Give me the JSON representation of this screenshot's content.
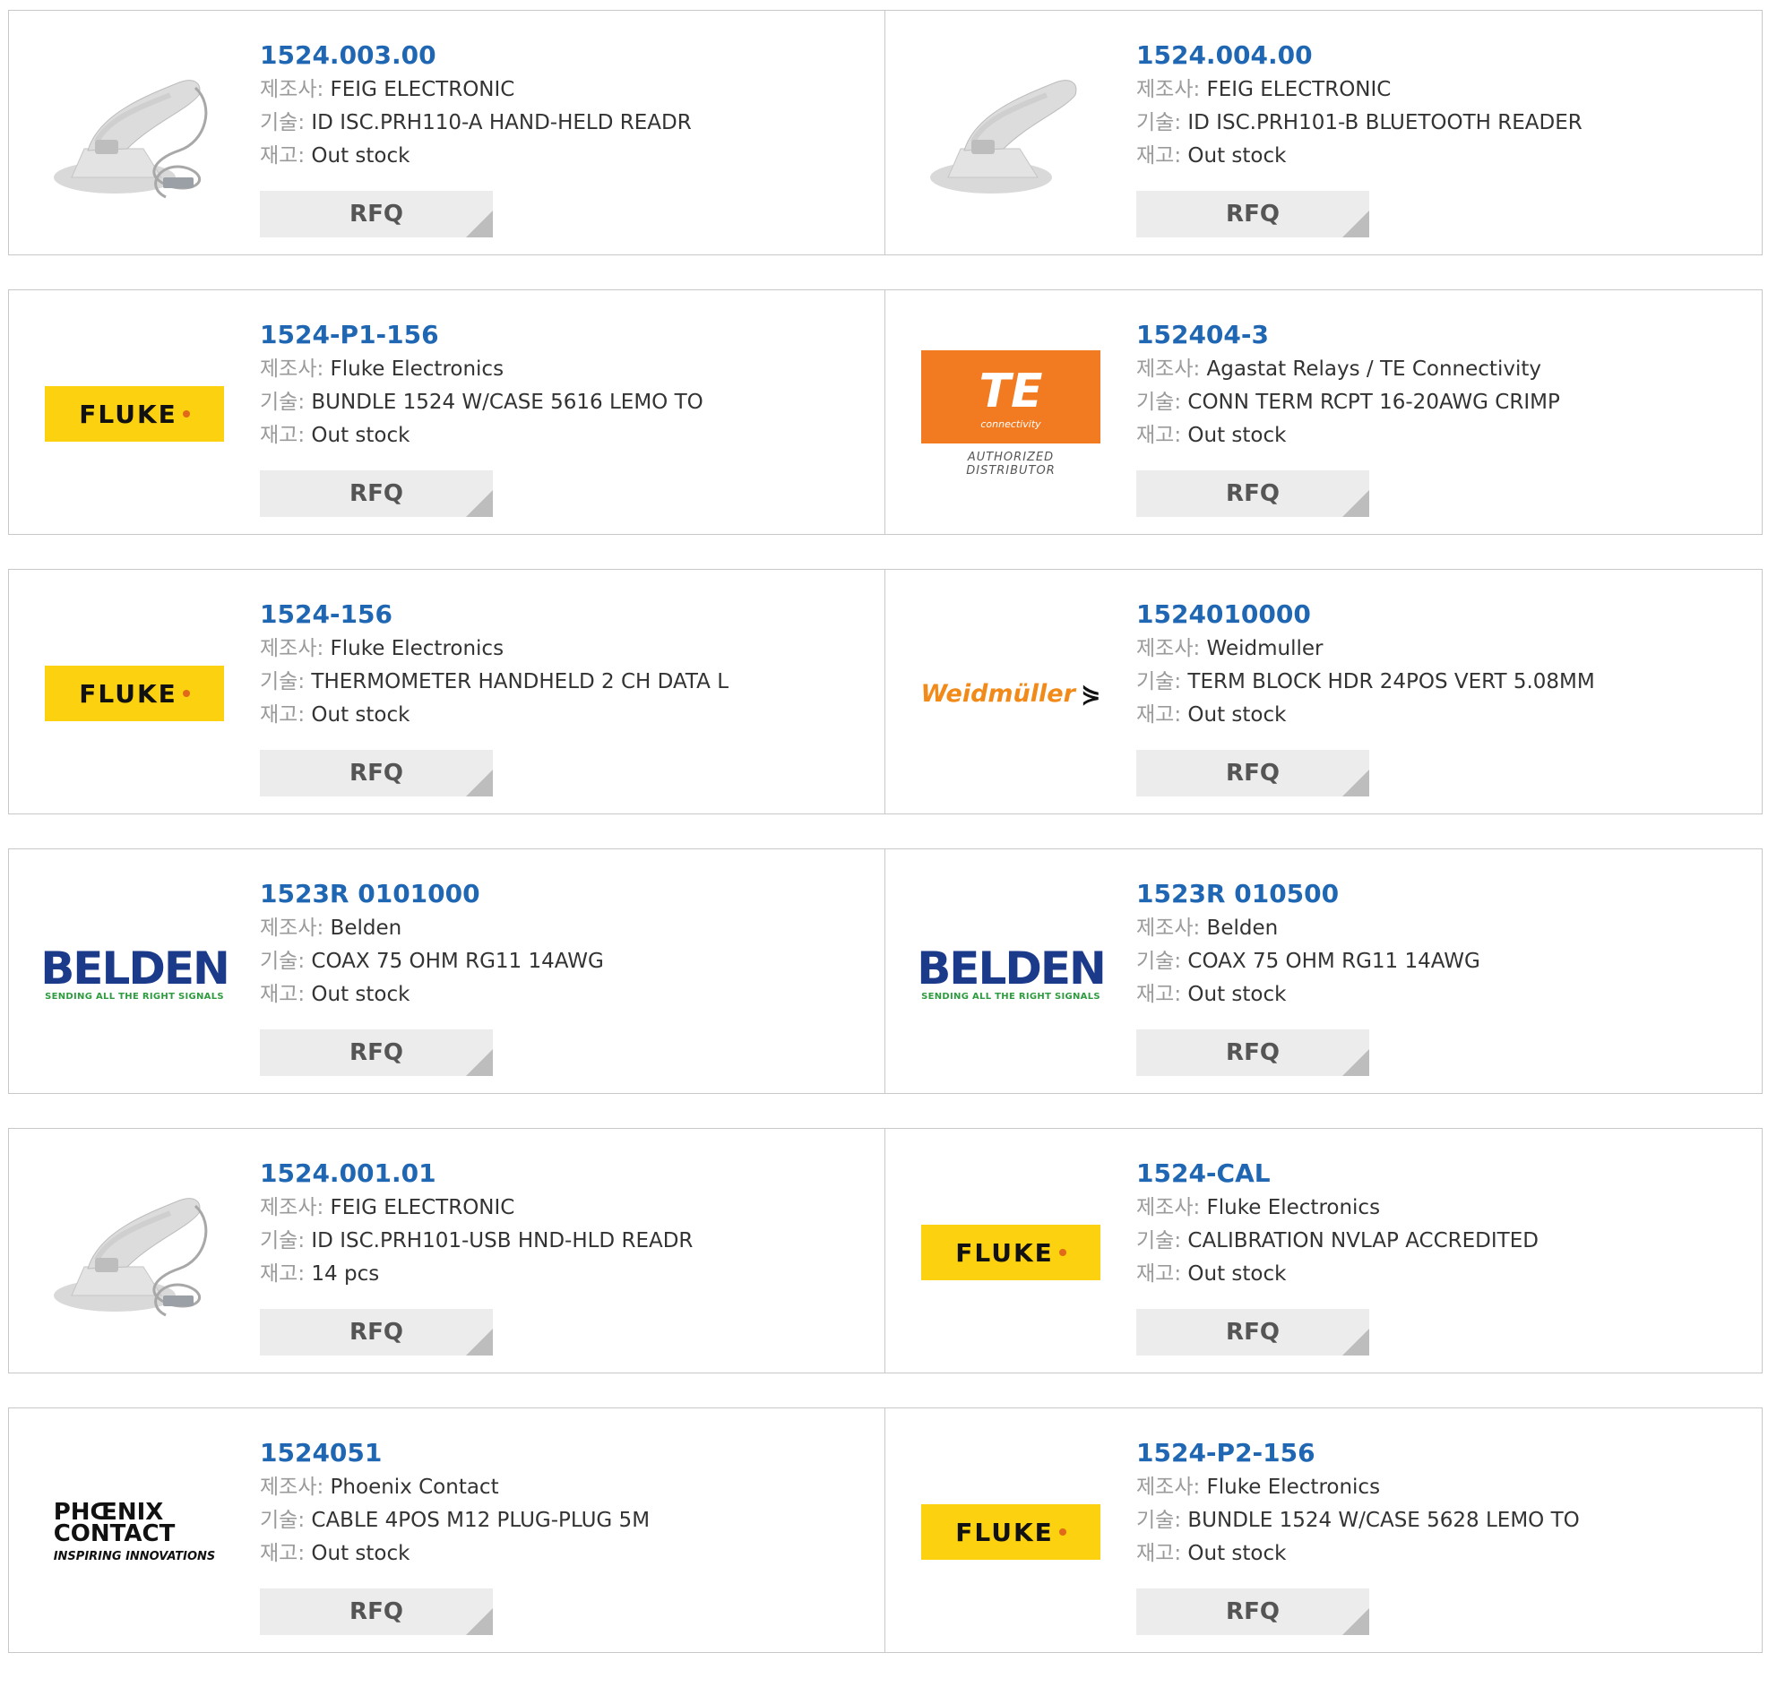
{
  "labels": {
    "manufacturer": "제조사:",
    "description": "기술:",
    "stock": "재고:",
    "rfq": "RFQ"
  },
  "products": [
    {
      "part": "1524.003.00",
      "manufacturer": "FEIG ELECTRONIC",
      "description": "ID ISC.PRH110-A HAND-HELD READR",
      "stock": "Out stock",
      "image": "scanner-cable"
    },
    {
      "part": "1524.004.00",
      "manufacturer": "FEIG ELECTRONIC",
      "description": "ID ISC.PRH101-B BLUETOOTH READER",
      "stock": "Out stock",
      "image": "scanner"
    },
    {
      "part": "1524-P1-156",
      "manufacturer": "Fluke Electronics",
      "description": "BUNDLE 1524 W/CASE 5616 LEMO TO",
      "stock": "Out stock",
      "image": "fluke"
    },
    {
      "part": "152404-3",
      "manufacturer": "Agastat Relays / TE Connectivity",
      "description": "CONN TERM RCPT 16-20AWG CRIMP",
      "stock": "Out stock",
      "image": "te"
    },
    {
      "part": "1524-156",
      "manufacturer": "Fluke Electronics",
      "description": "THERMOMETER HANDHELD 2 CH DATA L",
      "stock": "Out stock",
      "image": "fluke"
    },
    {
      "part": "1524010000",
      "manufacturer": "Weidmuller",
      "description": "TERM BLOCK HDR 24POS VERT 5.08MM",
      "stock": "Out stock",
      "image": "weidmuller"
    },
    {
      "part": "1523R 0101000",
      "manufacturer": "Belden",
      "description": "COAX 75 OHM RG11 14AWG",
      "stock": "Out stock",
      "image": "belden"
    },
    {
      "part": "1523R 010500",
      "manufacturer": "Belden",
      "description": "COAX 75 OHM RG11 14AWG",
      "stock": "Out stock",
      "image": "belden"
    },
    {
      "part": "1524.001.01",
      "manufacturer": "FEIG ELECTRONIC",
      "description": "ID ISC.PRH101-USB HND-HLD READR",
      "stock": "14 pcs",
      "image": "scanner-cable"
    },
    {
      "part": "1524-CAL",
      "manufacturer": "Fluke Electronics",
      "description": "CALIBRATION NVLAP ACCREDITED",
      "stock": "Out stock",
      "image": "fluke"
    },
    {
      "part": "1524051",
      "manufacturer": "Phoenix Contact",
      "description": "CABLE 4POS M12 PLUG-PLUG 5M",
      "stock": "Out stock",
      "image": "phoenix"
    },
    {
      "part": "1524-P2-156",
      "manufacturer": "Fluke Electronics",
      "description": "BUNDLE 1524 W/CASE 5628 LEMO TO",
      "stock": "Out stock",
      "image": "fluke"
    }
  ],
  "logos": {
    "fluke": "FLUKE",
    "te": {
      "mark": "TE",
      "small": "connectivity",
      "sub": "AUTHORIZED DISTRIBUTOR"
    },
    "weidmuller": {
      "name": "Weidmüller",
      "mark": "⋟"
    },
    "belden": {
      "name": "BELDEN",
      "tag": "SENDING ALL THE RIGHT SIGNALS"
    },
    "phoenix": {
      "line1": "PHŒNIX",
      "line2": "CONTACT",
      "tag": "INSPIRING INNOVATIONS"
    }
  },
  "colors": {
    "part_link": "#1f66b3",
    "label": "#9a9a9a",
    "button_bg": "#ececec",
    "fluke_yellow": "#fcd10f",
    "te_orange": "#f27a21",
    "belden_blue": "#1b3a8a"
  }
}
